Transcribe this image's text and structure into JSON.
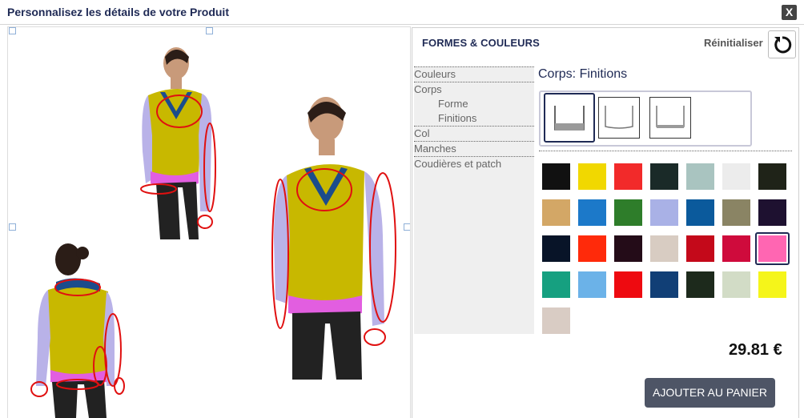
{
  "dialog": {
    "title": "Personnalisez les détails de votre Produit",
    "close_label": "X"
  },
  "panel": {
    "title": "FORMES & COULEURS",
    "reset_label": "Réinitialiser",
    "nav": [
      {
        "label": "Couleurs",
        "level": 0
      },
      {
        "label": "Corps",
        "level": 0
      },
      {
        "label": "Forme",
        "level": 1
      },
      {
        "label": "Finitions",
        "level": 1
      },
      {
        "label": "Col",
        "level": 0
      },
      {
        "label": "Manches",
        "level": 0
      },
      {
        "label": "Coudières et patch",
        "level": 0
      }
    ],
    "section_title": "Corps: Finitions",
    "finish_options": [
      "finish-ribbed-hem",
      "finish-plain-hem",
      "finish-narrow-hem"
    ],
    "selected_finish": 0,
    "swatches": [
      "#111111",
      "#f1d800",
      "#f22a2a",
      "#1a2a28",
      "#a9c4c0",
      "#ececec",
      "#1f2318",
      "#d3a766",
      "#1c79c9",
      "#2e7d2a",
      "#a9b1e6",
      "#0b5a9c",
      "#8a8464",
      "#1e1130",
      "#081428",
      "#ff2a0a",
      "#240c18",
      "#d8ccc2",
      "#c4091a",
      "#cf0b3c",
      "#ff66b2",
      "#16a080",
      "#6bb2e8",
      "#ee0a10",
      "#113f76",
      "#1d2a1c",
      "#d2dcc6",
      "#f5f51a",
      "#d9ccc4"
    ],
    "selected_swatch": 20,
    "price": "29.81 €",
    "cart_label": "AJOUTER AU PANIER"
  }
}
